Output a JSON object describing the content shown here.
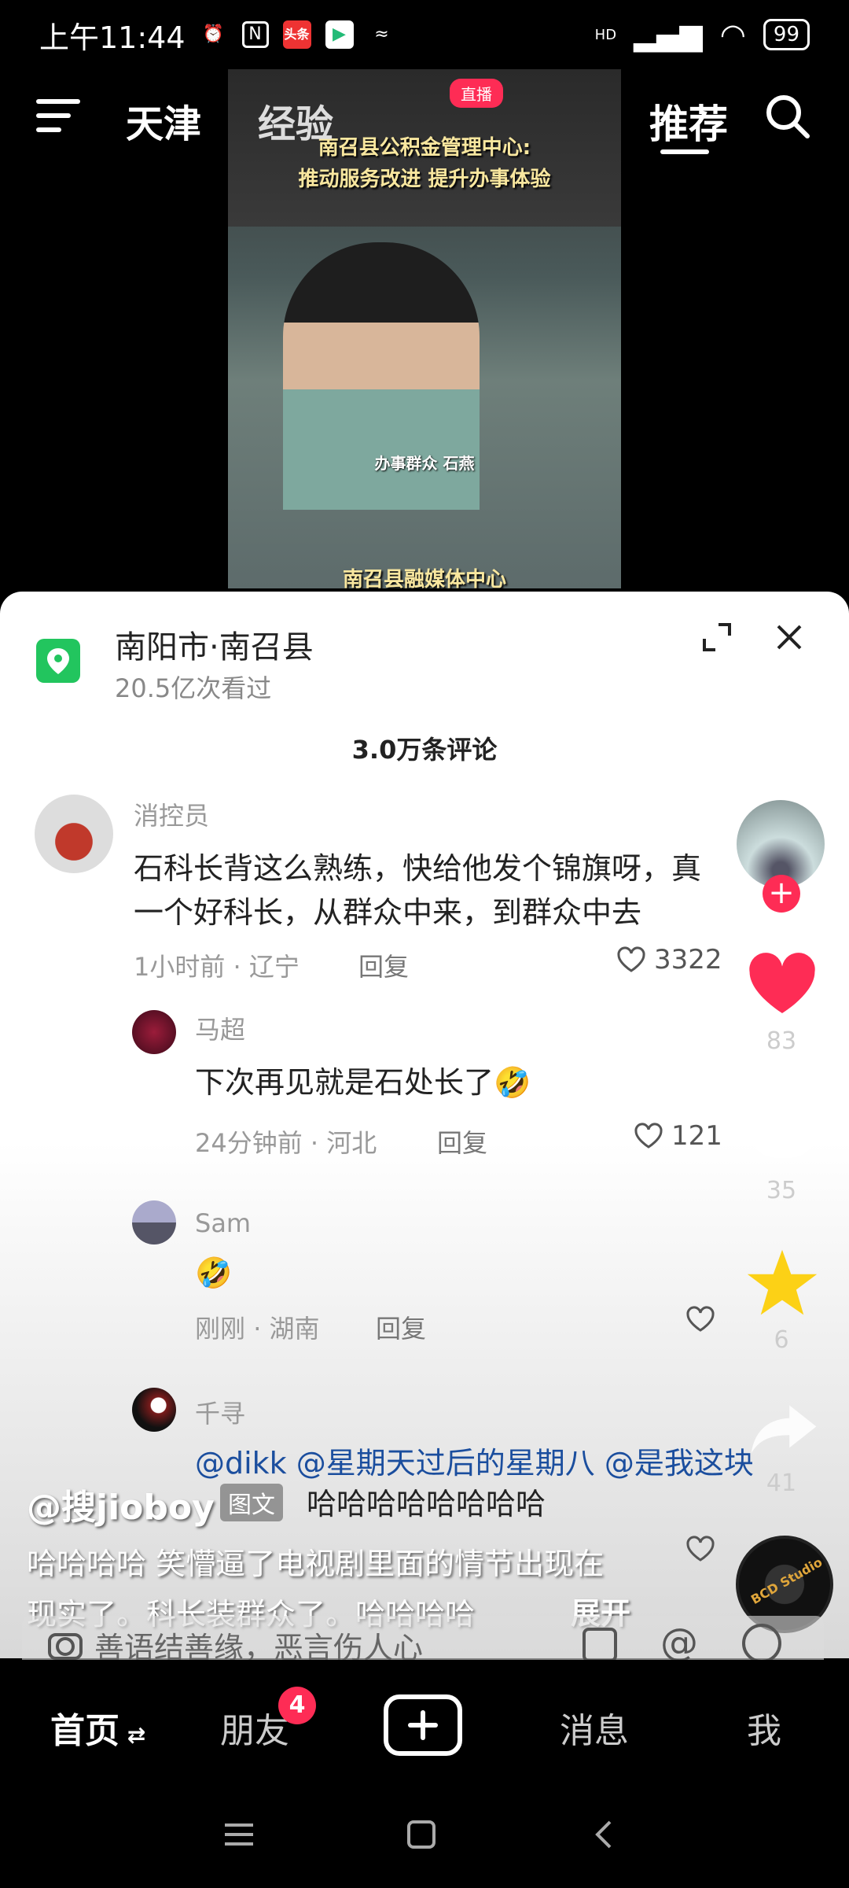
{
  "status_bar": {
    "time": "上午11:44",
    "app_icon_label": "头条",
    "network": "HD",
    "battery": "99"
  },
  "top_nav": {
    "city": "天津",
    "experience": "经验",
    "recommend": "推荐"
  },
  "video": {
    "headline_line1": "南召县公积金管理中心:",
    "headline_line2": "推动服务改进 提升办事体验",
    "caption": "办事群众  石燕",
    "source": "南召县融媒体中心",
    "live_badge": "直播"
  },
  "sheet": {
    "location_title": "南阳市·南召县",
    "views": "20.5亿次看过",
    "comment_count": "3.0万条评论"
  },
  "comments": [
    {
      "user": "消控员",
      "text_line1": "石科长背这么熟练，快给他发个锦旗呀，真",
      "text_line2": "一个好科长，从群众中来，到群众中去",
      "time": "1小时前",
      "region": "辽宁",
      "reply": "回复",
      "likes": "3322"
    },
    {
      "user": "马超",
      "text": "下次再见就是石处长了🤣",
      "time": "24分钟前",
      "region": "河北",
      "reply": "回复",
      "likes": "121"
    },
    {
      "user": "Sam",
      "text": "🤣",
      "time": "刚刚",
      "region": "湖南",
      "reply": "回复",
      "likes": ""
    },
    {
      "user": "千寻",
      "text": "@dikk @星期天过后的星期八 @是我这块",
      "text_line2": "哈哈哈哈哈哈哈哈"
    }
  ],
  "side": {
    "like_count": "83",
    "comment_count": "35",
    "star_count": "6",
    "share_count": "41",
    "disc_label": "BCD Studio"
  },
  "overlay": {
    "author": "@搜jioboy",
    "tag": "图文",
    "desc_line1": "哈哈哈哈 笑懵逼了电视剧里面的情节出现在",
    "desc_line2": "现实了。科长装群众了。哈哈哈哈",
    "expand": "展开",
    "input_placeholder": "善语结善缘，恶言伤人心"
  },
  "tabs": {
    "home": "首页",
    "friends": "朋友",
    "friend_badge": "4",
    "messages": "消息",
    "me": "我"
  },
  "colors": {
    "accent": "#fe2c55",
    "location_green": "#22c55e",
    "mention_blue": "#1b4e9e",
    "star": "#fcd116"
  }
}
